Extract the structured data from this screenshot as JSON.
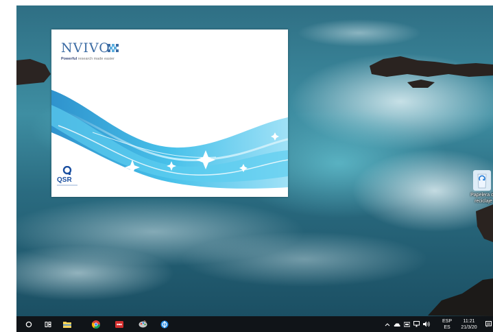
{
  "splash": {
    "product_name": "NVIVO",
    "tagline_bold": "Powerful",
    "tagline_rest": " research made easier",
    "company": "QSR"
  },
  "desktop_icons": {
    "recycle_bin_label": "Papelera de reciclaje"
  },
  "taskbar": {
    "language_line1": "ESP",
    "language_line2": "ES",
    "time": "11:21",
    "date": "21/3/20",
    "icons": [
      "cortana-search-icon",
      "task-view-icon",
      "file-explorer-icon",
      "chrome-icon",
      "app-red-icon",
      "app-paint-icon",
      "app-blue-icon"
    ],
    "tray_icons": [
      "show-hidden-icons-icon",
      "onedrive-icon",
      "wifi-icon",
      "network-icon",
      "volume-icon",
      "notification-icon"
    ]
  },
  "colors": {
    "taskbar_bg": "#101418",
    "sea_dark": "#1f5a6e",
    "sea_light": "#5fa6b8",
    "brand_blue": "#3b6ba3",
    "qsr_blue": "#1a4fa0"
  }
}
